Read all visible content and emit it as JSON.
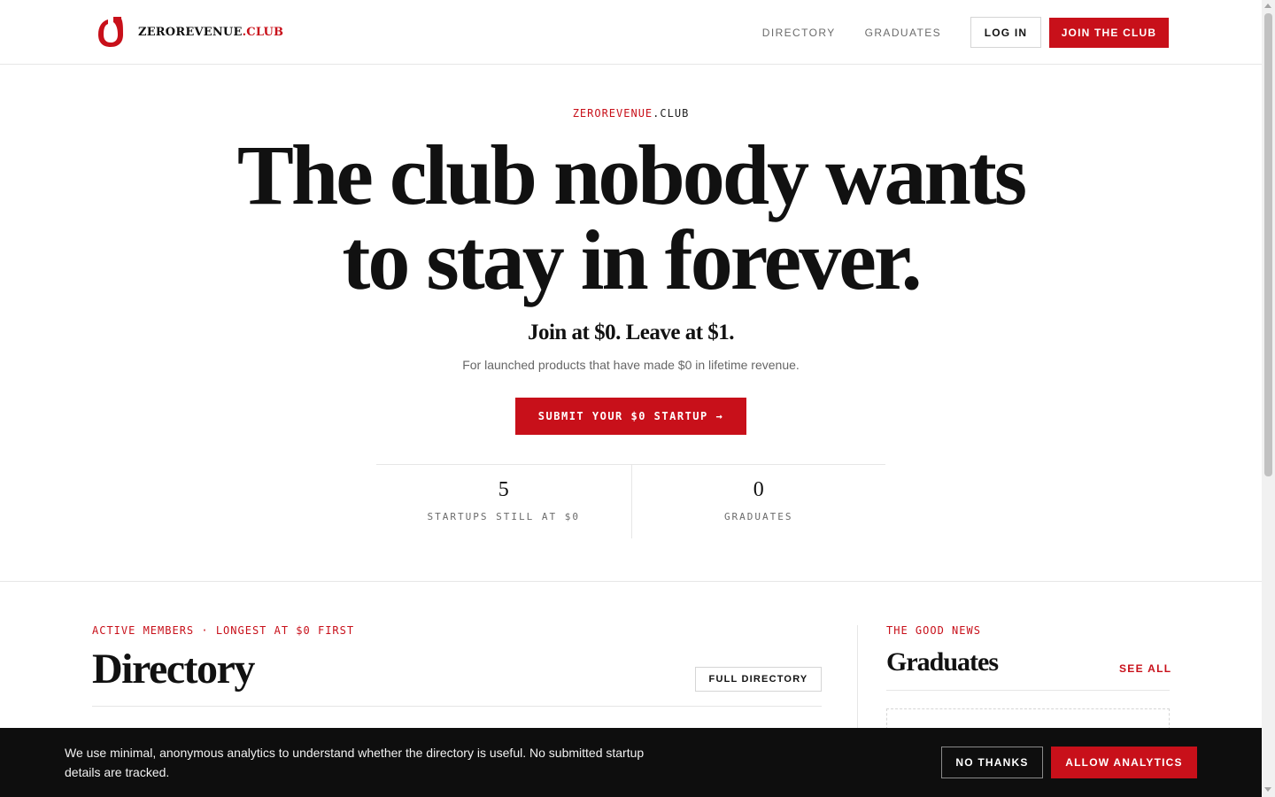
{
  "header": {
    "logo_text_main": "ZEROREVENUE",
    "logo_text_accent": ".CLUB",
    "nav": {
      "directory": "DIRECTORY",
      "graduates": "GRADUATES",
      "login": "LOG IN",
      "join": "JOIN THE CLUB"
    }
  },
  "hero": {
    "eyebrow_accent": "ZEROREVENUE",
    "eyebrow_main": ".CLUB",
    "title_line1": "The club nobody wants",
    "title_line2": "to stay in forever.",
    "subtitle": "Join at $0. Leave at $1.",
    "description": "For launched products that have made $0 in lifetime revenue.",
    "cta_label": "SUBMIT YOUR $0 STARTUP →",
    "stats": [
      {
        "value": "5",
        "label": "STARTUPS STILL AT $0"
      },
      {
        "value": "0",
        "label": "GRADUATES"
      }
    ]
  },
  "directory": {
    "eyebrow": "ACTIVE MEMBERS · LONGEST AT $0 FIRST",
    "title": "Directory",
    "button": "FULL DIRECTORY"
  },
  "graduates": {
    "eyebrow": "THE GOOD NEWS",
    "title": "Graduates",
    "see_all": "SEE ALL"
  },
  "cookie_banner": {
    "text": "We use minimal, anonymous analytics to understand whether the directory is useful. No submitted startup details are tracked.",
    "decline": "NO THANKS",
    "accept": "ALLOW ANALYTICS"
  },
  "colors": {
    "accent": "#c8101a",
    "banner_bg": "#0e0e0e"
  }
}
